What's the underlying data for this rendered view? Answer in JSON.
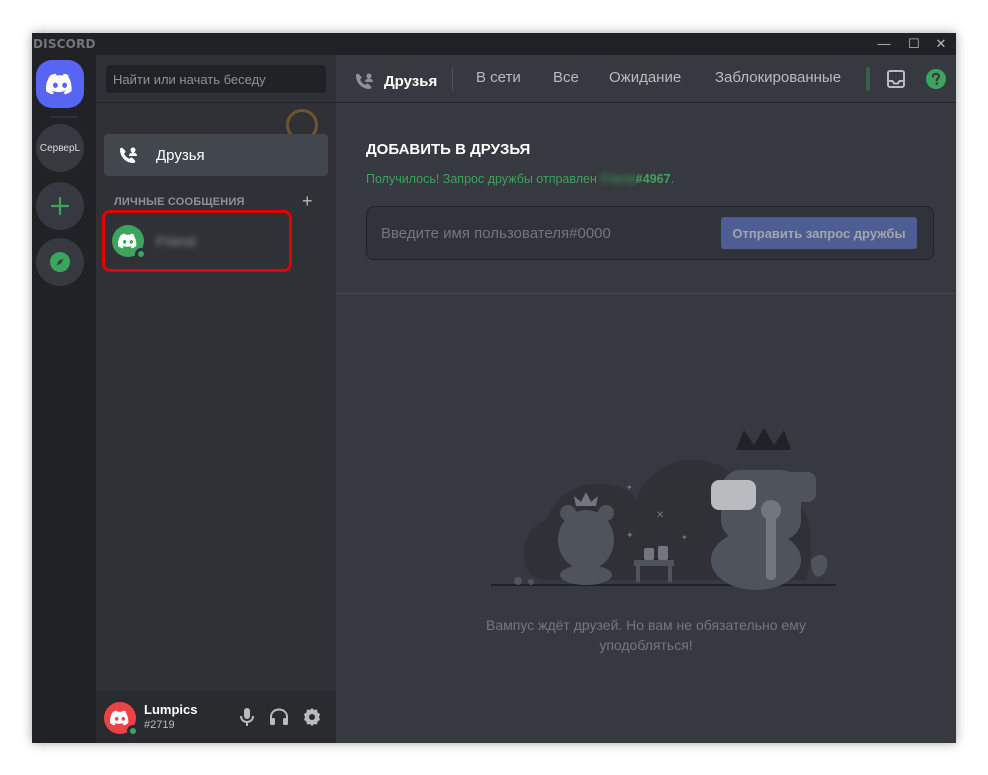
{
  "app": {
    "brand": "DISCORD"
  },
  "window_controls": {
    "minimize": "—",
    "maximize": "☐",
    "close": "✕"
  },
  "guilds": {
    "server_label": "СерверL"
  },
  "sidebar": {
    "search_placeholder": "Найти или начать беседу",
    "friends_label": "Друзья",
    "dm_header": "Личные сообщения",
    "dm_add": "+",
    "dm_items": [
      {
        "name": "Friend"
      }
    ]
  },
  "user": {
    "name": "Lumpics",
    "tag": "#2719"
  },
  "topbar": {
    "friends_label": "Друзья",
    "tabs": [
      "В сети",
      "Все",
      "Ожидание",
      "Заблокированные"
    ]
  },
  "add_friend": {
    "title": "Добавить в друзья",
    "success_prefix": "Получилось! Запрос дружбы отправлен ",
    "success_name": "Friend",
    "success_tag": "#4967",
    "success_suffix": ".",
    "input_placeholder": "Введите имя пользователя#0000",
    "button_label": "Отправить запрос дружбы"
  },
  "empty_state": {
    "line1": "Вампус ждёт друзей. Но вам не обязательно ему",
    "line2": "уподобляться!"
  },
  "colors": {
    "brand": "#5865f2",
    "online": "#3ba55d",
    "highlight": "#e30000",
    "user_avatar": "#ed4245"
  }
}
